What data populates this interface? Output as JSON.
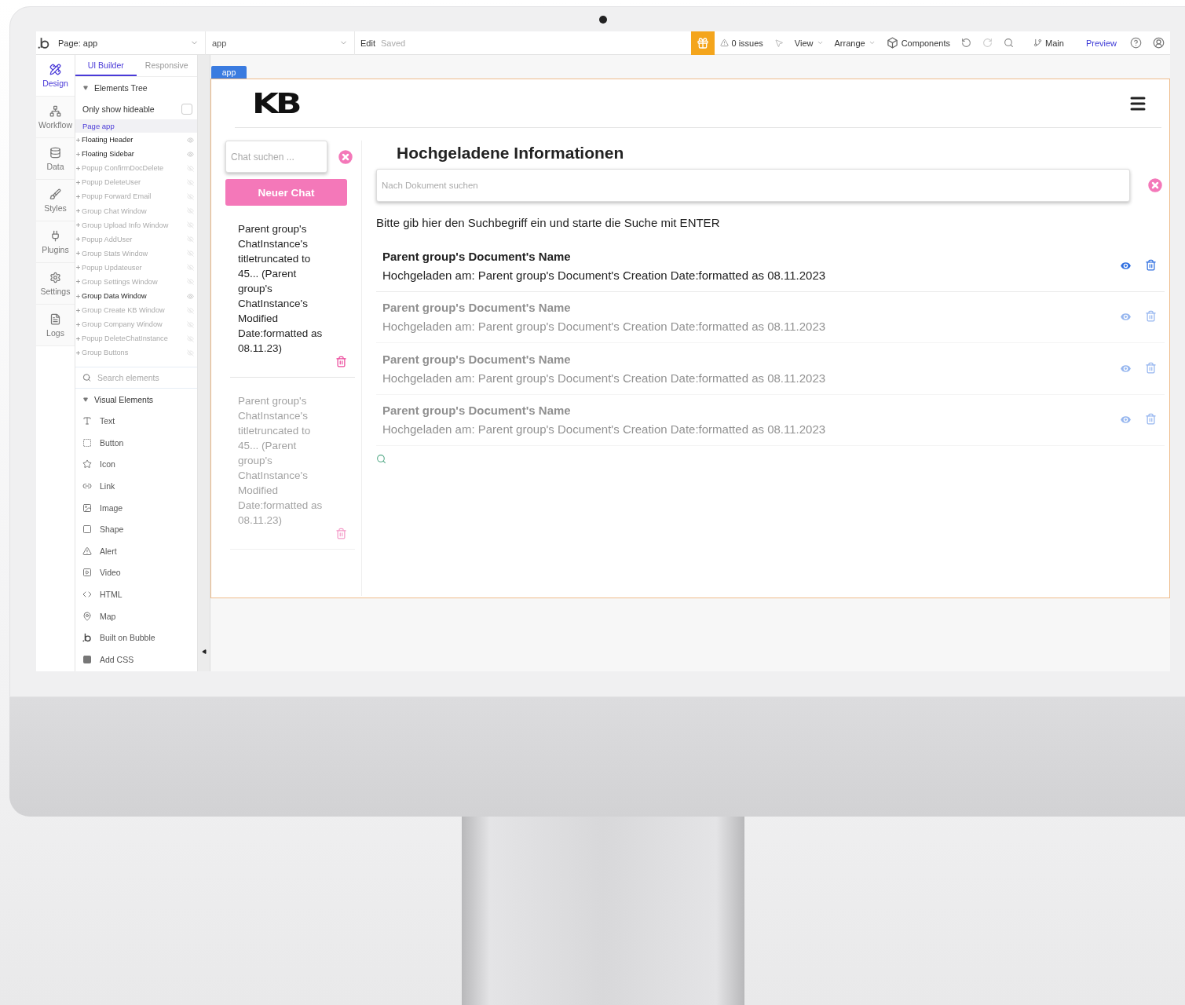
{
  "toolbar": {
    "page_selector": "Page: app",
    "element_selector": "app",
    "edit": "Edit",
    "save_status": "Saved",
    "issues": "0 issues",
    "view": "View",
    "arrange": "Arrange",
    "components": "Components",
    "branch": "Main",
    "preview": "Preview"
  },
  "rail": [
    {
      "label": "Design",
      "kind": "design",
      "selected": true
    },
    {
      "label": "Workflow",
      "kind": "workflow",
      "selected": false
    },
    {
      "label": "Data",
      "kind": "data",
      "selected": false
    },
    {
      "label": "Styles",
      "kind": "styles",
      "selected": false
    },
    {
      "label": "Plugins",
      "kind": "plugins",
      "selected": false
    },
    {
      "label": "Settings",
      "kind": "settings",
      "selected": false
    },
    {
      "label": "Logs",
      "kind": "logs",
      "selected": false
    }
  ],
  "panel_tabs": [
    {
      "label": "UI Builder",
      "selected": true
    },
    {
      "label": "Responsive",
      "selected": false
    }
  ],
  "elements_tree": {
    "title": "Elements Tree",
    "expanded": true,
    "filter": {
      "label": "Only show hideable",
      "checked": false
    },
    "root": {
      "label": "Page app",
      "selected": true,
      "children": [
        {
          "label": "Floating Header",
          "visible": true
        },
        {
          "label": "Floating Sidebar",
          "visible": true
        },
        {
          "label": "Popup ConfirmDocDelete",
          "visible": false
        },
        {
          "label": "Popup DeleteUser",
          "visible": false
        },
        {
          "label": "Popup Forward Email",
          "visible": false
        },
        {
          "label": "Group Chat Window",
          "visible": false
        },
        {
          "label": "Group Upload Info Window",
          "visible": false
        },
        {
          "label": "Popup AddUser",
          "visible": false
        },
        {
          "label": "Group Stats Window",
          "visible": false
        },
        {
          "label": "Popup Updateuser",
          "visible": false
        },
        {
          "label": "Group Settings Window",
          "visible": false
        },
        {
          "label": "Group Data Window",
          "visible": true
        },
        {
          "label": "Group Create KB Window",
          "visible": false
        },
        {
          "label": "Group Company Window",
          "visible": false
        },
        {
          "label": "Popup DeleteChatInstance",
          "visible": false
        },
        {
          "label": "Group Buttons",
          "visible": false
        }
      ]
    }
  },
  "element_search": {
    "placeholder": "Search elements"
  },
  "visual_elements": {
    "title": "Visual Elements",
    "expanded": true,
    "items": [
      {
        "label": "Text",
        "kind": "text"
      },
      {
        "label": "Button",
        "kind": "button"
      },
      {
        "label": "Icon",
        "kind": "icon"
      },
      {
        "label": "Link",
        "kind": "link"
      },
      {
        "label": "Image",
        "kind": "image"
      },
      {
        "label": "Shape",
        "kind": "shape"
      },
      {
        "label": "Alert",
        "kind": "alert"
      },
      {
        "label": "Video",
        "kind": "video"
      },
      {
        "label": "HTML",
        "kind": "html"
      },
      {
        "label": "Map",
        "kind": "map"
      },
      {
        "label": "Built on Bubble",
        "kind": "bubble"
      },
      {
        "label": "Add CSS",
        "kind": "css"
      }
    ]
  },
  "canvas": {
    "tag": "app",
    "logo": "KB",
    "chat_search": {
      "placeholder": "Chat suchen ..."
    },
    "new_chat": "Neuer Chat",
    "chats": [
      {
        "title": "Parent group's ChatInstance's titletruncated to 45... (Parent group's ChatInstance's Modified Date:formatted as 08.11.23)",
        "dimmed": false
      },
      {
        "title": "Parent group's ChatInstance's titletruncated to 45... (Parent group's ChatInstance's Modified Date:formatted as 08.11.23)",
        "dimmed": true
      }
    ],
    "heading": "Hochgeladene Informationen",
    "doc_search": {
      "placeholder": "Nach Dokument suchen"
    },
    "hint": "Bitte gib hier den Suchbegriff ein und starte die Suche mit ENTER",
    "documents": [
      {
        "name": "Parent group's Document's Name",
        "uploaded": "Hochgeladen am:  Parent group's Document's Creation Date:formatted as 08.11.2023",
        "dimmed": false
      },
      {
        "name": "Parent group's Document's Name",
        "uploaded": "Hochgeladen am:  Parent group's Document's Creation Date:formatted as 08.11.2023",
        "dimmed": true
      },
      {
        "name": "Parent group's Document's Name",
        "uploaded": "Hochgeladen am:  Parent group's Document's Creation Date:formatted as 08.11.2023",
        "dimmed": true
      },
      {
        "name": "Parent group's Document's Name",
        "uploaded": "Hochgeladen am:  Parent group's Document's Creation Date:formatted as 08.11.2023",
        "dimmed": true
      }
    ]
  }
}
